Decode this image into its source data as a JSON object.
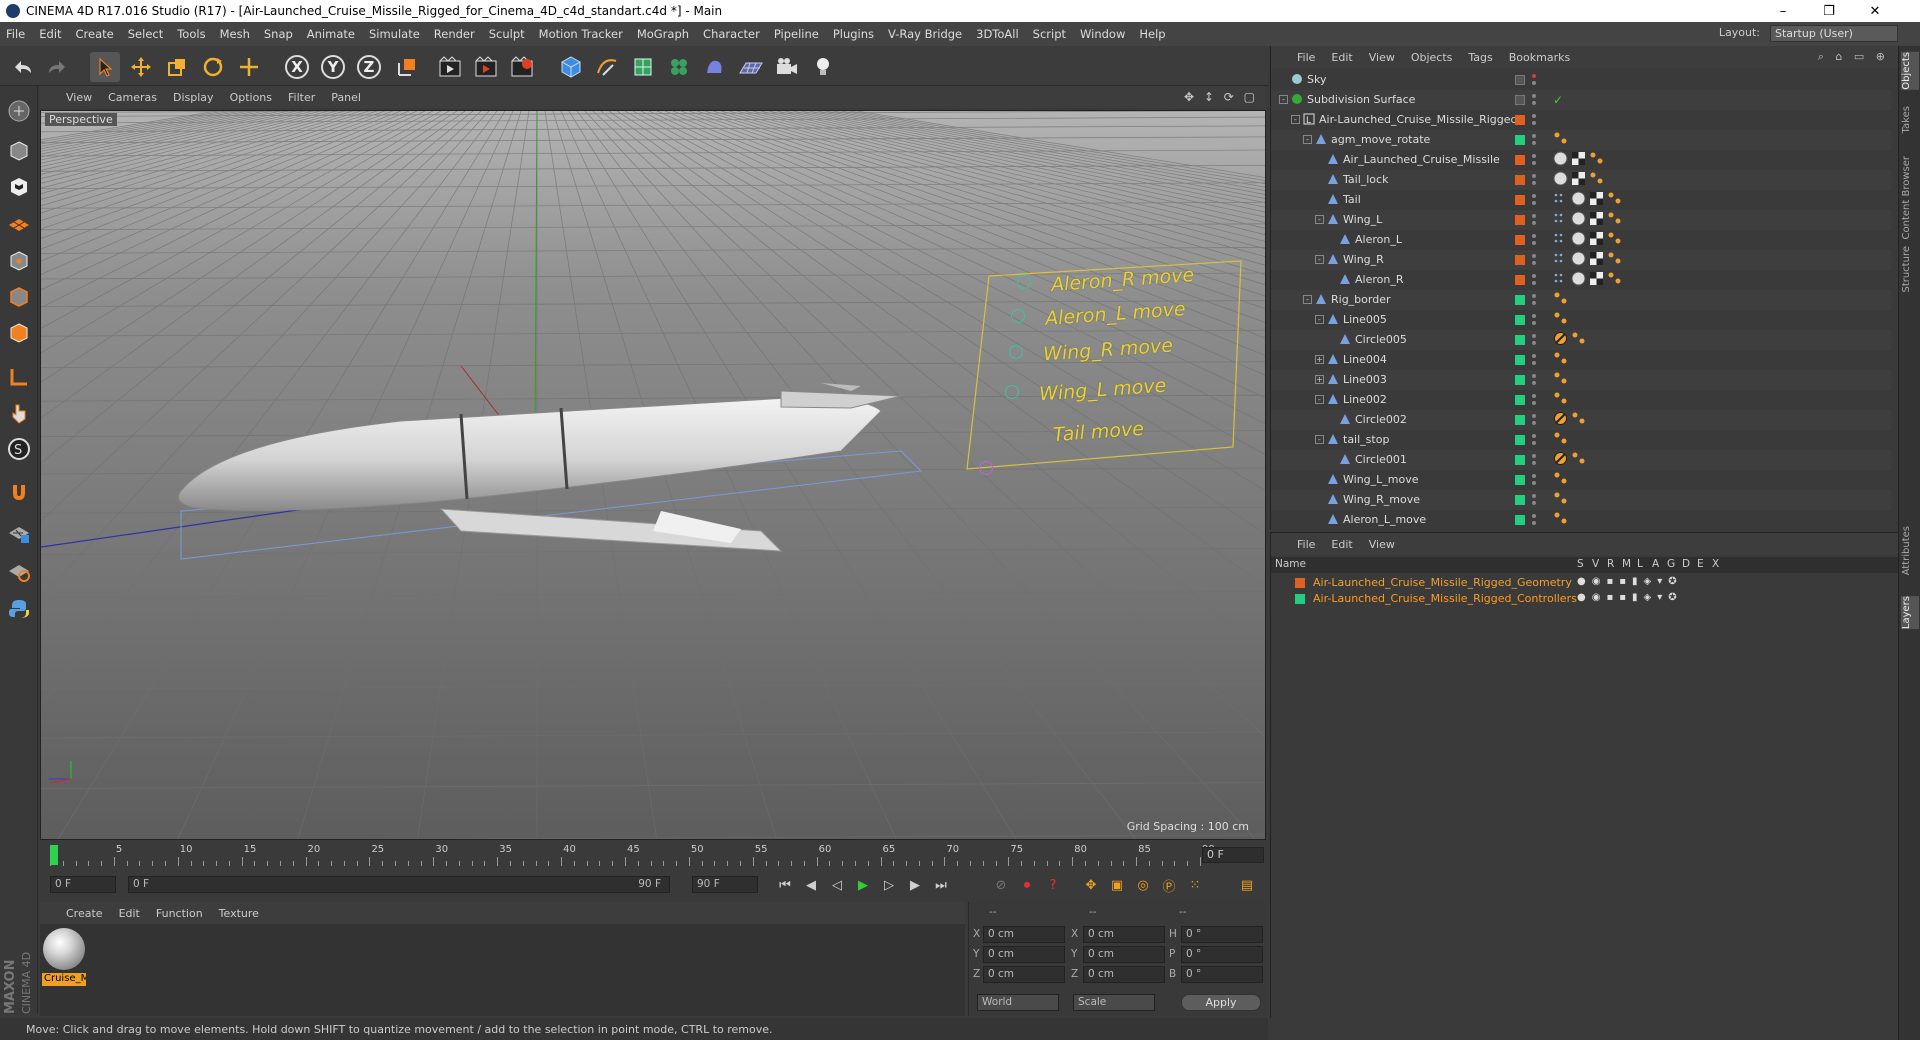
{
  "window": {
    "title": "CINEMA 4D R17.016 Studio (R17) - [Air-Launched_Cruise_Missile_Rigged_for_Cinema_4D_c4d_standart.c4d *] - Main",
    "controls": [
      "–",
      "❐",
      "✕"
    ]
  },
  "menubar": {
    "items": [
      "File",
      "Edit",
      "Create",
      "Select",
      "Tools",
      "Mesh",
      "Snap",
      "Animate",
      "Simulate",
      "Render",
      "Sculpt",
      "Motion Tracker",
      "MoGraph",
      "Character",
      "Pipeline",
      "Plugins",
      "V-Ray Bridge",
      "3DToAll",
      "Script",
      "Window",
      "Help"
    ],
    "layout_label": "Layout:",
    "layout_value": "Startup (User)"
  },
  "toolbar": {
    "x_label": "X",
    "y_label": "Y",
    "z_label": "Z"
  },
  "viewport": {
    "menu": [
      "View",
      "Cameras",
      "Display",
      "Options",
      "Filter",
      "Panel"
    ],
    "label": "Perspective",
    "grid_spacing": "Grid Spacing : 100 cm",
    "controller_labels": [
      "Aleron_R move",
      "Aleron_L move",
      "Wing_R move",
      "Wing_L move",
      "Tail move"
    ]
  },
  "timeline": {
    "ticks": [
      "0",
      "5",
      "10",
      "15",
      "20",
      "25",
      "30",
      "35",
      "40",
      "45",
      "50",
      "55",
      "60",
      "65",
      "70",
      "75",
      "80",
      "85",
      "90"
    ],
    "current_frame": "0 F"
  },
  "transport": {
    "start_field": "0 F",
    "range_start": "0 F",
    "range_end": "90 F",
    "end_field": "90 F"
  },
  "material_manager": {
    "menu": [
      "Create",
      "Edit",
      "Function",
      "Texture"
    ],
    "materials": [
      {
        "name": "Cruise_M"
      }
    ]
  },
  "coordinates": {
    "header": [
      "--",
      "--",
      "--"
    ],
    "rows": [
      {
        "axis": "X",
        "pos": "0 cm",
        "size_axis": "X",
        "size": "0 cm",
        "rot_axis": "H",
        "rot": "0 °"
      },
      {
        "axis": "Y",
        "pos": "0 cm",
        "size_axis": "Y",
        "size": "0 cm",
        "rot_axis": "P",
        "rot": "0 °"
      },
      {
        "axis": "Z",
        "pos": "0 cm",
        "size_axis": "Z",
        "size": "0 cm",
        "rot_axis": "B",
        "rot": "0 °"
      }
    ],
    "mode1": "World",
    "mode2": "Scale",
    "apply": "Apply"
  },
  "status": "Move: Click and drag to move elements. Hold down SHIFT to quantize movement / add to the selection in point mode, CTRL to remove.",
  "branding": "MAXON CINEMA 4D",
  "object_manager": {
    "menu": [
      "File",
      "Edit",
      "View",
      "Objects",
      "Tags",
      "Bookmarks"
    ],
    "objects": [
      {
        "name": "Sky",
        "depth": 0,
        "exp": "",
        "layer": "",
        "tags": []
      },
      {
        "name": "Subdivision Surface",
        "depth": 0,
        "exp": "-",
        "layer": "",
        "tags": [
          "check"
        ]
      },
      {
        "name": "Air-Launched_Cruise_Missile_Rigged",
        "depth": 1,
        "exp": "-",
        "layer": "#e06020",
        "tags": []
      },
      {
        "name": "agm_move_rotate",
        "depth": 2,
        "exp": "-",
        "layer": "#20d080",
        "tags": [
          "bone"
        ]
      },
      {
        "name": "Air_Launched_Cruise_Missile",
        "depth": 3,
        "exp": "",
        "layer": "#e06020",
        "tags": [
          "ball",
          "chk",
          "bone"
        ]
      },
      {
        "name": "Tail_lock",
        "depth": 3,
        "exp": "",
        "layer": "#e06020",
        "tags": [
          "ball",
          "chk",
          "bone"
        ]
      },
      {
        "name": "Tail",
        "depth": 3,
        "exp": "",
        "layer": "#e06020",
        "tags": [
          "dots",
          "ball",
          "chk",
          "bone"
        ]
      },
      {
        "name": "Wing_L",
        "depth": 3,
        "exp": "-",
        "layer": "#e06020",
        "tags": [
          "dots",
          "ball",
          "chk",
          "bone"
        ]
      },
      {
        "name": "Aleron_L",
        "depth": 4,
        "exp": "",
        "layer": "#e06020",
        "tags": [
          "dots",
          "ball",
          "chk",
          "bone"
        ]
      },
      {
        "name": "Wing_R",
        "depth": 3,
        "exp": "-",
        "layer": "#e06020",
        "tags": [
          "dots",
          "ball",
          "chk",
          "bone"
        ]
      },
      {
        "name": "Aleron_R",
        "depth": 4,
        "exp": "",
        "layer": "#e06020",
        "tags": [
          "dots",
          "ball",
          "chk",
          "bone"
        ]
      },
      {
        "name": "Rig_border",
        "depth": 2,
        "exp": "-",
        "layer": "#20d080",
        "tags": [
          "bone"
        ]
      },
      {
        "name": "Line005",
        "depth": 3,
        "exp": "-",
        "layer": "#20d080",
        "tags": [
          "bone"
        ]
      },
      {
        "name": "Circle005",
        "depth": 4,
        "exp": "",
        "layer": "#20d080",
        "tags": [
          "stop",
          "bone"
        ]
      },
      {
        "name": "Line004",
        "depth": 3,
        "exp": "+",
        "layer": "#20d080",
        "tags": [
          "bone"
        ]
      },
      {
        "name": "Line003",
        "depth": 3,
        "exp": "+",
        "layer": "#20d080",
        "tags": [
          "bone"
        ]
      },
      {
        "name": "Line002",
        "depth": 3,
        "exp": "-",
        "layer": "#20d080",
        "tags": [
          "bone"
        ]
      },
      {
        "name": "Circle002",
        "depth": 4,
        "exp": "",
        "layer": "#20d080",
        "tags": [
          "stop",
          "bone"
        ]
      },
      {
        "name": "tail_stop",
        "depth": 3,
        "exp": "-",
        "layer": "#20d080",
        "tags": [
          "bone"
        ]
      },
      {
        "name": "Circle001",
        "depth": 4,
        "exp": "",
        "layer": "#20d080",
        "tags": [
          "stop",
          "bone"
        ]
      },
      {
        "name": "Wing_L_move",
        "depth": 3,
        "exp": "",
        "layer": "#20d080",
        "tags": [
          "bone"
        ]
      },
      {
        "name": "Wing_R_move",
        "depth": 3,
        "exp": "",
        "layer": "#20d080",
        "tags": [
          "bone"
        ]
      },
      {
        "name": "Aleron_L_move",
        "depth": 3,
        "exp": "",
        "layer": "#20d080",
        "tags": [
          "bone"
        ]
      }
    ]
  },
  "layer_manager": {
    "menu": [
      "File",
      "Edit",
      "View"
    ],
    "header_name": "Name",
    "columns": [
      "S",
      "V",
      "R",
      "M",
      "L",
      "A",
      "G",
      "D",
      "E",
      "X"
    ],
    "layers": [
      {
        "name": "Air-Launched_Cruise_Missile_Rigged_Geometry",
        "color": "#e06020"
      },
      {
        "name": "Air-Launched_Cruise_Missile_Rigged_Controllers",
        "color": "#20d080"
      }
    ]
  },
  "right_dock_tabs": [
    "Objects",
    "Takes",
    "Content Browser",
    "Structure",
    "Attributes",
    "Layers"
  ]
}
